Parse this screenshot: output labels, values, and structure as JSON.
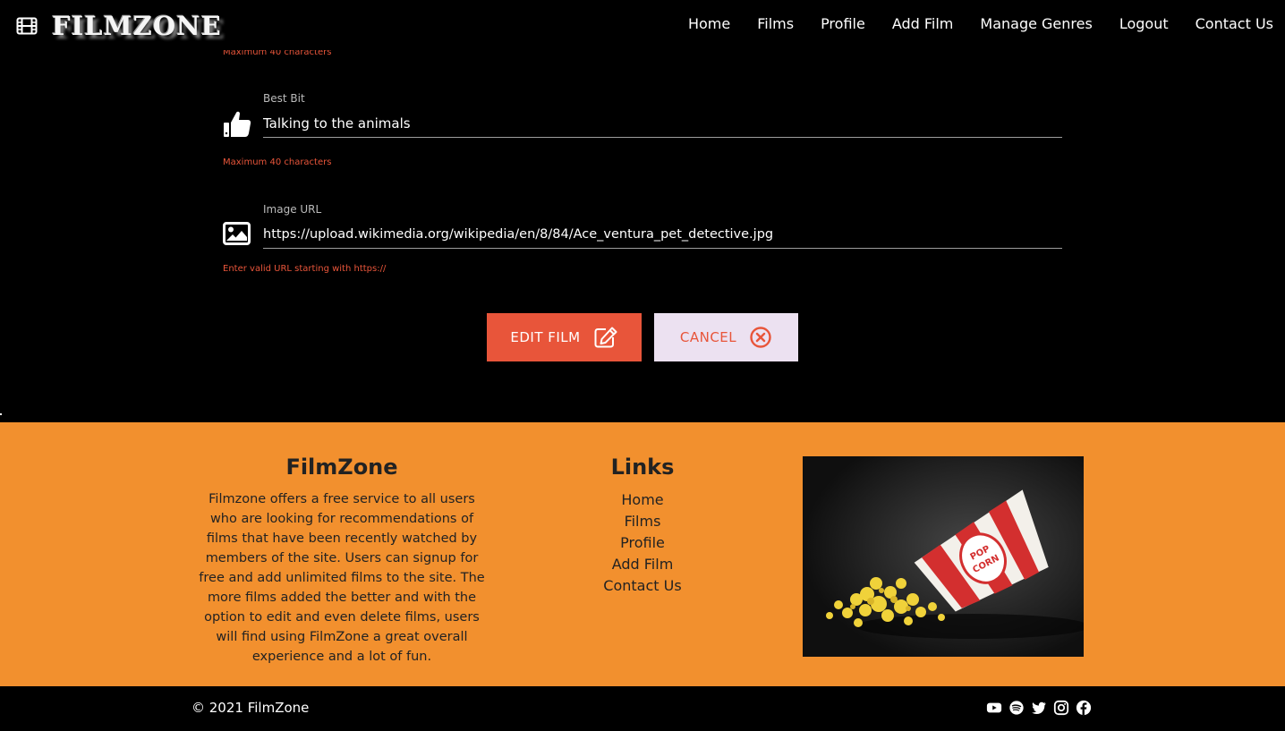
{
  "brand": {
    "name": "FILMZONE"
  },
  "nav": {
    "items": [
      "Home",
      "Films",
      "Profile",
      "Add Film",
      "Manage Genres",
      "Logout",
      "Contact Us"
    ]
  },
  "form": {
    "partial_hint": "Maximum 40 characters",
    "best_bit": {
      "label": "Best Bit",
      "value": "Talking to the animals",
      "helper": "Maximum 40 characters"
    },
    "image_url": {
      "label": "Image URL",
      "value": "https://upload.wikimedia.org/wikipedia/en/8/84/Ace_ventura_pet_detective.jpg",
      "helper": "Enter valid URL starting with https://"
    },
    "edit_button": "EDIT FILM",
    "cancel_button": "CANCEL"
  },
  "footer": {
    "about_title": "FilmZone",
    "about_text": "Filmzone offers a free service to all users who are looking for recommendations of films that have been recently watched by members of the site. Users can signup for free and add unlimited films to the site. The more films added the better and with the option to edit and even delete films, users will find using FilmZone a great overall experience and a lot of fun.",
    "links_title": "Links",
    "links": [
      "Home",
      "Films",
      "Profile",
      "Add Film",
      "Contact Us"
    ],
    "image_caption_text": "POP CORN",
    "copyright": "© 2021 FilmZone",
    "socials": [
      "youtube-icon",
      "spotify-icon",
      "twitter-icon",
      "instagram-icon",
      "facebook-icon"
    ]
  },
  "colors": {
    "accent": "#e8553a",
    "footer_bg": "#f2902e",
    "cancel_bg": "#ece1f1"
  }
}
